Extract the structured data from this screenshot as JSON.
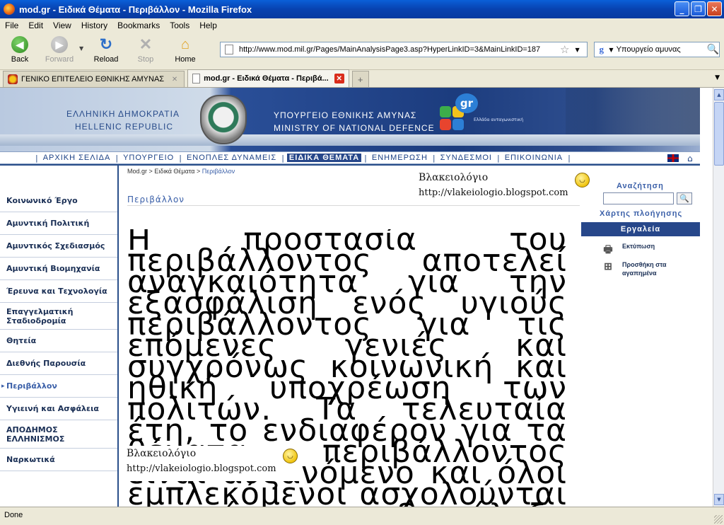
{
  "window": {
    "title": "mod.gr - Ειδικά Θέματα - Περιβάλλον - Mozilla Firefox"
  },
  "menu": [
    "File",
    "Edit",
    "View",
    "History",
    "Bookmarks",
    "Tools",
    "Help"
  ],
  "toolbar": {
    "back": "Back",
    "forward": "Forward",
    "reload": "Reload",
    "stop": "Stop",
    "home": "Home"
  },
  "url": "http://www.mod.mil.gr/Pages/MainAnalysisPage3.asp?HyperLinkID=3&MainLinkID=187",
  "websearch": {
    "value": "Υπουργείο αμυνας",
    "engine_icon": "google-icon"
  },
  "tabs": [
    {
      "label": "ΓΕΝΙΚΟ ΕΠΙΤΕΛΕΙΟ ΕΘΝΙΚΗΣ ΑΜΥΝΑΣ"
    },
    {
      "label": "mod.gr - Ειδικά Θέματα - Περιβά..."
    }
  ],
  "site": {
    "republic_gr": "ΕΛΛΗΝΙΚΗ ΔΗΜΟΚΡΑΤΙΑ",
    "republic_en": "HELLENIC REPUBLIC",
    "ministry_gr": "ΥΠΟΥΡΓΕΙΟ ΕΘΝΙΚΗΣ ΑΜΥΝΑΣ",
    "ministry_en": "MINISTRY OF NATIONAL DEFENCE",
    "gr_logo": "gr",
    "gr_logo_tag": "Ελλάδα ανταγωνιστική"
  },
  "topnav": [
    {
      "label": "ΑΡΧΙΚΗ ΣΕΛΙΔΑ"
    },
    {
      "label": "ΥΠΟΥΡΓΕΙΟ"
    },
    {
      "label": "ΕΝΟΠΛΕΣ ΔΥΝΑΜΕΙΣ"
    },
    {
      "label": "ΕΙΔΙΚΑ ΘΕΜΑΤΑ",
      "active": true
    },
    {
      "label": "ΕΝΗΜΕΡΩΣΗ"
    },
    {
      "label": "ΣΥΝΔΕΣΜΟΙ"
    },
    {
      "label": "ΕΠΙΚΟΙΝΩΝΙΑ"
    }
  ],
  "sidebar": [
    "Κοινωνικό Έργο",
    "Αμυντική Πολιτική",
    "Αμυντικός Σχεδιασμός",
    "Αμυντική Βιομηχανία",
    "Έρευνα και Τεχνολογία",
    "Επαγγελματική Σταδιοδρομία",
    "Θητεία",
    "Διεθνής Παρουσία",
    "Περιβάλλον",
    "Υγιεινή και Ασφάλεια",
    "ΑΠΟΔΗΜΟΣ ΕΛΛΗΝΙΣΜΟΣ",
    "Ναρκωτικά"
  ],
  "sidebar_active": "Περιβάλλον",
  "breadcrumb": {
    "home": "Mod.gr",
    "sep": ">",
    "section": "Ειδικά Θέματα",
    "current": "Περιβάλλον"
  },
  "page": {
    "title": "Περιβάλλον",
    "body": "Η προστασία του περιβάλλοντος αποτελεί αναγκαιότητα για την εξασφάλιση ενός υγιούς περιβάλλοντος για τις επόμενες γενιές και συγχρόνως κοινωνική και ηθική υποχρέωση των πολιτών. Τα τελευταία έτη, το ενδιαφέρον για τα θέματα περιβάλλοντος είναι αυξανόμενο και όλοι εμπλεκόμενοι ασχολούνται ενεργά με τη διαφύλαξη της οικολογικής ισορροπίας. Σε αυτήν ακριβώς την κατεύθυνση κινούνται οι Ένοπλες Δυνάμεις, οι οποίες αναλαμβάνουν πρωτοβουλίες σε όλα τα επίπεδα δράσης τους."
  },
  "watermark": {
    "title": "Βλακειολόγιο",
    "url": "http://vlakeiologio.blogspot.com"
  },
  "right": {
    "search_label": "Αναζήτηση",
    "sitemap": "Χάρτης πλοήγησης",
    "tools_title": "Εργαλεία",
    "print": "Εκτύπωση",
    "favorites": "Προσθήκη στα αγαπημένα"
  },
  "status": "Done"
}
